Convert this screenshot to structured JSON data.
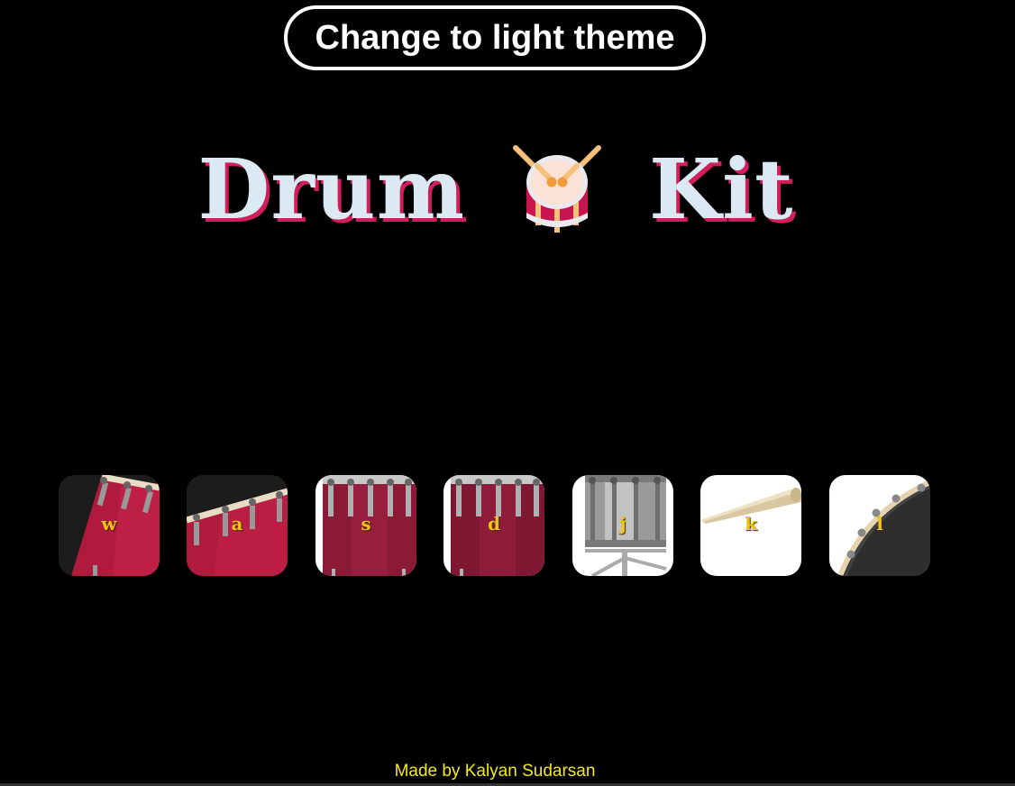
{
  "theme_button": {
    "label": "Change to light theme"
  },
  "title": {
    "word1": "Drum",
    "word2": "Kit",
    "emoji": "drum-icon"
  },
  "drums": [
    {
      "key": "w",
      "kind": "tom-red-tilted"
    },
    {
      "key": "a",
      "kind": "tom-red-tilted"
    },
    {
      "key": "s",
      "kind": "snare-red"
    },
    {
      "key": "d",
      "kind": "snare-red"
    },
    {
      "key": "j",
      "kind": "snare-silver"
    },
    {
      "key": "k",
      "kind": "drumstick"
    },
    {
      "key": "l",
      "kind": "bass-black"
    }
  ],
  "footer": {
    "text": "Made by Kalyan Sudarsan"
  },
  "colors": {
    "background": "#000000",
    "title_fill": "#dbe9f2",
    "title_shadow": "#d01d5c",
    "key_label": "#f2c21a",
    "footer_text": "#f5ea16"
  }
}
